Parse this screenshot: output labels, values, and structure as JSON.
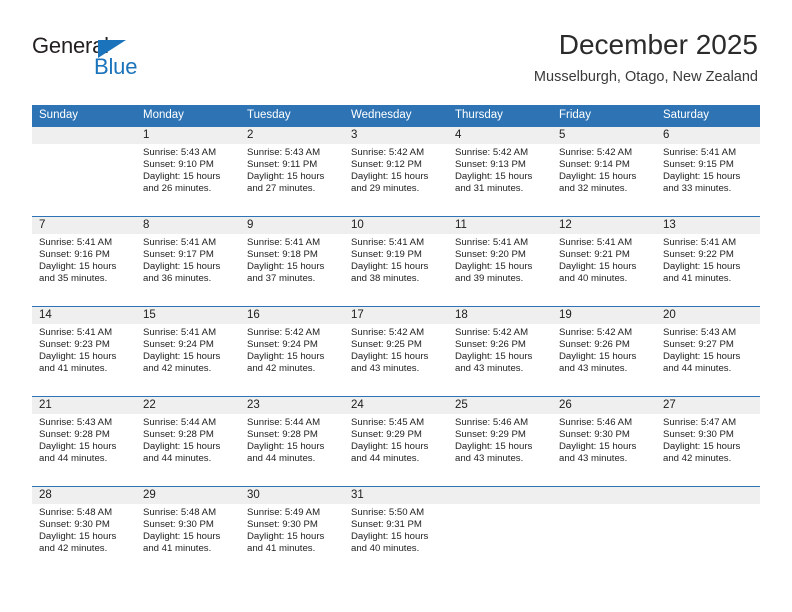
{
  "brand": {
    "name_part1": "General",
    "name_part2": "Blue",
    "triangle_color": "#1b74bb",
    "text_color": "#231f20"
  },
  "header": {
    "title": "December 2025",
    "subtitle": "Musselburgh, Otago, New Zealand"
  },
  "theme": {
    "header_blue": "#2e74b5",
    "daynum_band": "#efefef",
    "cell_background": "#ffffff",
    "text": "#222222"
  },
  "weekdays": [
    "Sunday",
    "Monday",
    "Tuesday",
    "Wednesday",
    "Thursday",
    "Friday",
    "Saturday"
  ],
  "weeks": [
    {
      "numbers": [
        "",
        "1",
        "2",
        "3",
        "4",
        "5",
        "6"
      ],
      "cells": [
        {
          "lines": [
            "",
            "",
            "",
            ""
          ]
        },
        {
          "lines": [
            "Sunrise: 5:43 AM",
            "Sunset: 9:10 PM",
            "Daylight: 15 hours",
            "and 26 minutes."
          ]
        },
        {
          "lines": [
            "Sunrise: 5:43 AM",
            "Sunset: 9:11 PM",
            "Daylight: 15 hours",
            "and 27 minutes."
          ]
        },
        {
          "lines": [
            "Sunrise: 5:42 AM",
            "Sunset: 9:12 PM",
            "Daylight: 15 hours",
            "and 29 minutes."
          ]
        },
        {
          "lines": [
            "Sunrise: 5:42 AM",
            "Sunset: 9:13 PM",
            "Daylight: 15 hours",
            "and 31 minutes."
          ]
        },
        {
          "lines": [
            "Sunrise: 5:42 AM",
            "Sunset: 9:14 PM",
            "Daylight: 15 hours",
            "and 32 minutes."
          ]
        },
        {
          "lines": [
            "Sunrise: 5:41 AM",
            "Sunset: 9:15 PM",
            "Daylight: 15 hours",
            "and 33 minutes."
          ]
        }
      ]
    },
    {
      "numbers": [
        "7",
        "8",
        "9",
        "10",
        "11",
        "12",
        "13"
      ],
      "cells": [
        {
          "lines": [
            "Sunrise: 5:41 AM",
            "Sunset: 9:16 PM",
            "Daylight: 15 hours",
            "and 35 minutes."
          ]
        },
        {
          "lines": [
            "Sunrise: 5:41 AM",
            "Sunset: 9:17 PM",
            "Daylight: 15 hours",
            "and 36 minutes."
          ]
        },
        {
          "lines": [
            "Sunrise: 5:41 AM",
            "Sunset: 9:18 PM",
            "Daylight: 15 hours",
            "and 37 minutes."
          ]
        },
        {
          "lines": [
            "Sunrise: 5:41 AM",
            "Sunset: 9:19 PM",
            "Daylight: 15 hours",
            "and 38 minutes."
          ]
        },
        {
          "lines": [
            "Sunrise: 5:41 AM",
            "Sunset: 9:20 PM",
            "Daylight: 15 hours",
            "and 39 minutes."
          ]
        },
        {
          "lines": [
            "Sunrise: 5:41 AM",
            "Sunset: 9:21 PM",
            "Daylight: 15 hours",
            "and 40 minutes."
          ]
        },
        {
          "lines": [
            "Sunrise: 5:41 AM",
            "Sunset: 9:22 PM",
            "Daylight: 15 hours",
            "and 41 minutes."
          ]
        }
      ]
    },
    {
      "numbers": [
        "14",
        "15",
        "16",
        "17",
        "18",
        "19",
        "20"
      ],
      "cells": [
        {
          "lines": [
            "Sunrise: 5:41 AM",
            "Sunset: 9:23 PM",
            "Daylight: 15 hours",
            "and 41 minutes."
          ]
        },
        {
          "lines": [
            "Sunrise: 5:41 AM",
            "Sunset: 9:24 PM",
            "Daylight: 15 hours",
            "and 42 minutes."
          ]
        },
        {
          "lines": [
            "Sunrise: 5:42 AM",
            "Sunset: 9:24 PM",
            "Daylight: 15 hours",
            "and 42 minutes."
          ]
        },
        {
          "lines": [
            "Sunrise: 5:42 AM",
            "Sunset: 9:25 PM",
            "Daylight: 15 hours",
            "and 43 minutes."
          ]
        },
        {
          "lines": [
            "Sunrise: 5:42 AM",
            "Sunset: 9:26 PM",
            "Daylight: 15 hours",
            "and 43 minutes."
          ]
        },
        {
          "lines": [
            "Sunrise: 5:42 AM",
            "Sunset: 9:26 PM",
            "Daylight: 15 hours",
            "and 43 minutes."
          ]
        },
        {
          "lines": [
            "Sunrise: 5:43 AM",
            "Sunset: 9:27 PM",
            "Daylight: 15 hours",
            "and 44 minutes."
          ]
        }
      ]
    },
    {
      "numbers": [
        "21",
        "22",
        "23",
        "24",
        "25",
        "26",
        "27"
      ],
      "cells": [
        {
          "lines": [
            "Sunrise: 5:43 AM",
            "Sunset: 9:28 PM",
            "Daylight: 15 hours",
            "and 44 minutes."
          ]
        },
        {
          "lines": [
            "Sunrise: 5:44 AM",
            "Sunset: 9:28 PM",
            "Daylight: 15 hours",
            "and 44 minutes."
          ]
        },
        {
          "lines": [
            "Sunrise: 5:44 AM",
            "Sunset: 9:28 PM",
            "Daylight: 15 hours",
            "and 44 minutes."
          ]
        },
        {
          "lines": [
            "Sunrise: 5:45 AM",
            "Sunset: 9:29 PM",
            "Daylight: 15 hours",
            "and 44 minutes."
          ]
        },
        {
          "lines": [
            "Sunrise: 5:46 AM",
            "Sunset: 9:29 PM",
            "Daylight: 15 hours",
            "and 43 minutes."
          ]
        },
        {
          "lines": [
            "Sunrise: 5:46 AM",
            "Sunset: 9:30 PM",
            "Daylight: 15 hours",
            "and 43 minutes."
          ]
        },
        {
          "lines": [
            "Sunrise: 5:47 AM",
            "Sunset: 9:30 PM",
            "Daylight: 15 hours",
            "and 42 minutes."
          ]
        }
      ]
    },
    {
      "numbers": [
        "28",
        "29",
        "30",
        "31",
        "",
        "",
        ""
      ],
      "cells": [
        {
          "lines": [
            "Sunrise: 5:48 AM",
            "Sunset: 9:30 PM",
            "Daylight: 15 hours",
            "and 42 minutes."
          ]
        },
        {
          "lines": [
            "Sunrise: 5:48 AM",
            "Sunset: 9:30 PM",
            "Daylight: 15 hours",
            "and 41 minutes."
          ]
        },
        {
          "lines": [
            "Sunrise: 5:49 AM",
            "Sunset: 9:30 PM",
            "Daylight: 15 hours",
            "and 41 minutes."
          ]
        },
        {
          "lines": [
            "Sunrise: 5:50 AM",
            "Sunset: 9:31 PM",
            "Daylight: 15 hours",
            "and 40 minutes."
          ]
        },
        {
          "lines": [
            "",
            "",
            "",
            ""
          ]
        },
        {
          "lines": [
            "",
            "",
            "",
            ""
          ]
        },
        {
          "lines": [
            "",
            "",
            "",
            ""
          ]
        }
      ]
    }
  ]
}
